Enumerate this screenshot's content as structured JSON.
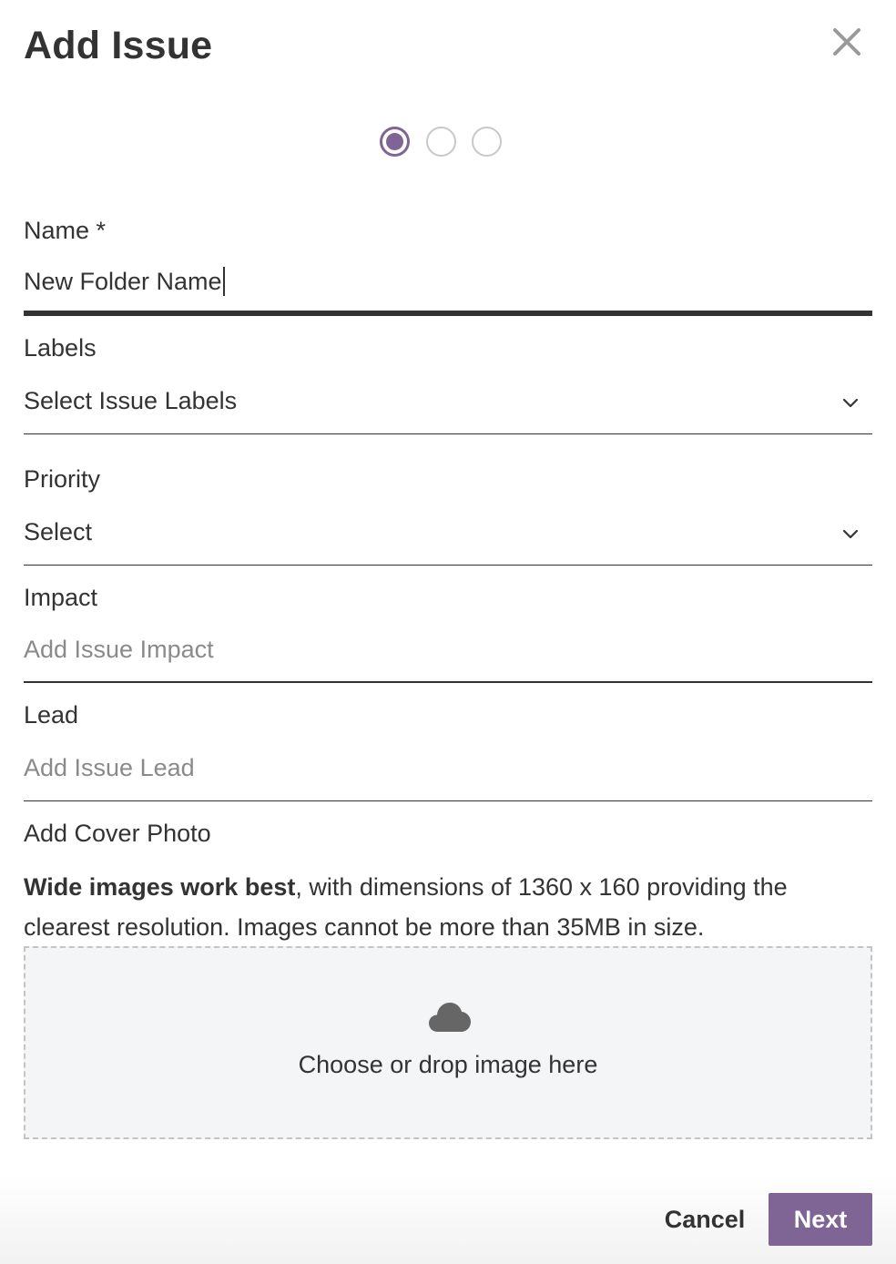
{
  "dialog": {
    "title": "Add Issue",
    "close_icon": "close-icon",
    "accent_color": "#7f6496"
  },
  "stepper": {
    "total_steps": 3,
    "current_step": 1
  },
  "fields": {
    "name": {
      "label": "Name *",
      "value": "New Folder Name"
    },
    "labels": {
      "label": "Labels",
      "placeholder": "Select Issue Labels",
      "icon": "chevron-down-icon"
    },
    "priority": {
      "label": "Priority",
      "placeholder": "Select",
      "icon": "chevron-down-icon"
    },
    "impact": {
      "label": "Impact",
      "placeholder": "Add Issue Impact"
    },
    "lead": {
      "label": "Lead",
      "placeholder": "Add Issue Lead"
    }
  },
  "cover_photo": {
    "label": "Add Cover Photo",
    "help_bold": "Wide images work best",
    "help_rest": ", with dimensions of 1360 x 160 providing the clearest resolution. Images cannot be more than 35MB in size.",
    "dropzone_text": "Choose or drop image here",
    "dropzone_icon": "cloud-icon"
  },
  "footer": {
    "cancel_label": "Cancel",
    "next_label": "Next"
  }
}
